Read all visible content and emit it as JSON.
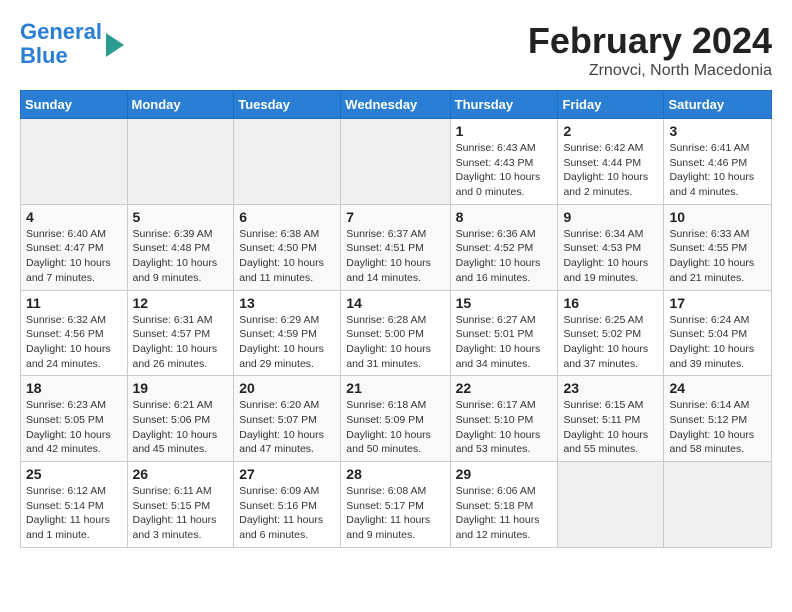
{
  "header": {
    "logo_line1": "General",
    "logo_line2": "Blue",
    "title": "February 2024",
    "subtitle": "Zrnovci, North Macedonia"
  },
  "calendar": {
    "days_of_week": [
      "Sunday",
      "Monday",
      "Tuesday",
      "Wednesday",
      "Thursday",
      "Friday",
      "Saturday"
    ],
    "weeks": [
      [
        {
          "day": "",
          "info": ""
        },
        {
          "day": "",
          "info": ""
        },
        {
          "day": "",
          "info": ""
        },
        {
          "day": "",
          "info": ""
        },
        {
          "day": "1",
          "info": "Sunrise: 6:43 AM\nSunset: 4:43 PM\nDaylight: 10 hours\nand 0 minutes."
        },
        {
          "day": "2",
          "info": "Sunrise: 6:42 AM\nSunset: 4:44 PM\nDaylight: 10 hours\nand 2 minutes."
        },
        {
          "day": "3",
          "info": "Sunrise: 6:41 AM\nSunset: 4:46 PM\nDaylight: 10 hours\nand 4 minutes."
        }
      ],
      [
        {
          "day": "4",
          "info": "Sunrise: 6:40 AM\nSunset: 4:47 PM\nDaylight: 10 hours\nand 7 minutes."
        },
        {
          "day": "5",
          "info": "Sunrise: 6:39 AM\nSunset: 4:48 PM\nDaylight: 10 hours\nand 9 minutes."
        },
        {
          "day": "6",
          "info": "Sunrise: 6:38 AM\nSunset: 4:50 PM\nDaylight: 10 hours\nand 11 minutes."
        },
        {
          "day": "7",
          "info": "Sunrise: 6:37 AM\nSunset: 4:51 PM\nDaylight: 10 hours\nand 14 minutes."
        },
        {
          "day": "8",
          "info": "Sunrise: 6:36 AM\nSunset: 4:52 PM\nDaylight: 10 hours\nand 16 minutes."
        },
        {
          "day": "9",
          "info": "Sunrise: 6:34 AM\nSunset: 4:53 PM\nDaylight: 10 hours\nand 19 minutes."
        },
        {
          "day": "10",
          "info": "Sunrise: 6:33 AM\nSunset: 4:55 PM\nDaylight: 10 hours\nand 21 minutes."
        }
      ],
      [
        {
          "day": "11",
          "info": "Sunrise: 6:32 AM\nSunset: 4:56 PM\nDaylight: 10 hours\nand 24 minutes."
        },
        {
          "day": "12",
          "info": "Sunrise: 6:31 AM\nSunset: 4:57 PM\nDaylight: 10 hours\nand 26 minutes."
        },
        {
          "day": "13",
          "info": "Sunrise: 6:29 AM\nSunset: 4:59 PM\nDaylight: 10 hours\nand 29 minutes."
        },
        {
          "day": "14",
          "info": "Sunrise: 6:28 AM\nSunset: 5:00 PM\nDaylight: 10 hours\nand 31 minutes."
        },
        {
          "day": "15",
          "info": "Sunrise: 6:27 AM\nSunset: 5:01 PM\nDaylight: 10 hours\nand 34 minutes."
        },
        {
          "day": "16",
          "info": "Sunrise: 6:25 AM\nSunset: 5:02 PM\nDaylight: 10 hours\nand 37 minutes."
        },
        {
          "day": "17",
          "info": "Sunrise: 6:24 AM\nSunset: 5:04 PM\nDaylight: 10 hours\nand 39 minutes."
        }
      ],
      [
        {
          "day": "18",
          "info": "Sunrise: 6:23 AM\nSunset: 5:05 PM\nDaylight: 10 hours\nand 42 minutes."
        },
        {
          "day": "19",
          "info": "Sunrise: 6:21 AM\nSunset: 5:06 PM\nDaylight: 10 hours\nand 45 minutes."
        },
        {
          "day": "20",
          "info": "Sunrise: 6:20 AM\nSunset: 5:07 PM\nDaylight: 10 hours\nand 47 minutes."
        },
        {
          "day": "21",
          "info": "Sunrise: 6:18 AM\nSunset: 5:09 PM\nDaylight: 10 hours\nand 50 minutes."
        },
        {
          "day": "22",
          "info": "Sunrise: 6:17 AM\nSunset: 5:10 PM\nDaylight: 10 hours\nand 53 minutes."
        },
        {
          "day": "23",
          "info": "Sunrise: 6:15 AM\nSunset: 5:11 PM\nDaylight: 10 hours\nand 55 minutes."
        },
        {
          "day": "24",
          "info": "Sunrise: 6:14 AM\nSunset: 5:12 PM\nDaylight: 10 hours\nand 58 minutes."
        }
      ],
      [
        {
          "day": "25",
          "info": "Sunrise: 6:12 AM\nSunset: 5:14 PM\nDaylight: 11 hours\nand 1 minute."
        },
        {
          "day": "26",
          "info": "Sunrise: 6:11 AM\nSunset: 5:15 PM\nDaylight: 11 hours\nand 3 minutes."
        },
        {
          "day": "27",
          "info": "Sunrise: 6:09 AM\nSunset: 5:16 PM\nDaylight: 11 hours\nand 6 minutes."
        },
        {
          "day": "28",
          "info": "Sunrise: 6:08 AM\nSunset: 5:17 PM\nDaylight: 11 hours\nand 9 minutes."
        },
        {
          "day": "29",
          "info": "Sunrise: 6:06 AM\nSunset: 5:18 PM\nDaylight: 11 hours\nand 12 minutes."
        },
        {
          "day": "",
          "info": ""
        },
        {
          "day": "",
          "info": ""
        }
      ]
    ]
  }
}
